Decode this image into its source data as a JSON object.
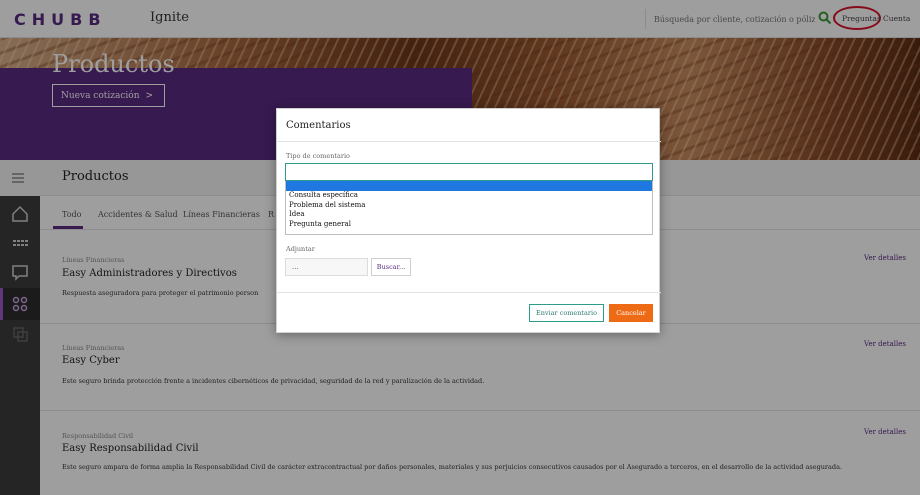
{
  "header": {
    "logo_text": "CHUBB",
    "app_name": "Ignite",
    "search_placeholder": "Búsqueda por cliente, cotización o póliza",
    "nav_questions": "Preguntas",
    "nav_account": "Cuenta"
  },
  "hero": {
    "title": "Productos",
    "new_quote_label": "Nueva cotización",
    "new_quote_chevron": ">"
  },
  "main": {
    "section_title": "Productos",
    "tabs": [
      {
        "label": "Todo",
        "active": true
      },
      {
        "label": "Accidentes & Salud",
        "active": false
      },
      {
        "label": "Líneas Financieras",
        "active": false
      },
      {
        "label": "R",
        "active": false
      }
    ],
    "cards": [
      {
        "category": "Líneas Financieras",
        "title": "Easy Administradores y Directivos",
        "description": "Respuesta aseguradora para proteger el patrimonio person",
        "link": "Ver detalles"
      },
      {
        "category": "Líneas Financieras",
        "title": "Easy Cyber",
        "description": "Este seguro brinda protección frente a incidentes cibernéticos de privacidad, seguridad de la red y paralización de la actividad.",
        "link": "Ver detalles"
      },
      {
        "category": "Responsabilidad Civil",
        "title": "Easy Responsabilidad Civil",
        "description": "Este seguro ampara de forma amplia la Responsabilidad Civil de carácter extracontractual por daños personales, materiales y sus perjuicios consecutivos causados por el Asegurado a terceros, en el desarrollo de la actividad asegurada.",
        "link": "Ver detalles"
      }
    ]
  },
  "modal": {
    "title": "Comentarios",
    "type_label": "Tipo de comentario",
    "type_value": "",
    "options": [
      "",
      "Consulta específica",
      "Problema del sistema",
      "Idea",
      "Pregunta general"
    ],
    "attach_label": "Adjuntar",
    "attach_value": "...",
    "browse_label": "Buscar...",
    "submit_label": "Enviar comentario",
    "cancel_label": "Cancelar"
  },
  "colors": {
    "brand_purple": "#5a2a82",
    "accent_orange": "#ef6a14",
    "accent_teal": "#2e9c8d",
    "annotation_red": "#d8132a",
    "highlight_blue": "#1f78e0"
  },
  "icons": [
    "search-icon",
    "menu-icon",
    "home-icon",
    "grid-icon",
    "chat-icon",
    "apps-icon",
    "layers-icon",
    "chevron-right-icon"
  ]
}
